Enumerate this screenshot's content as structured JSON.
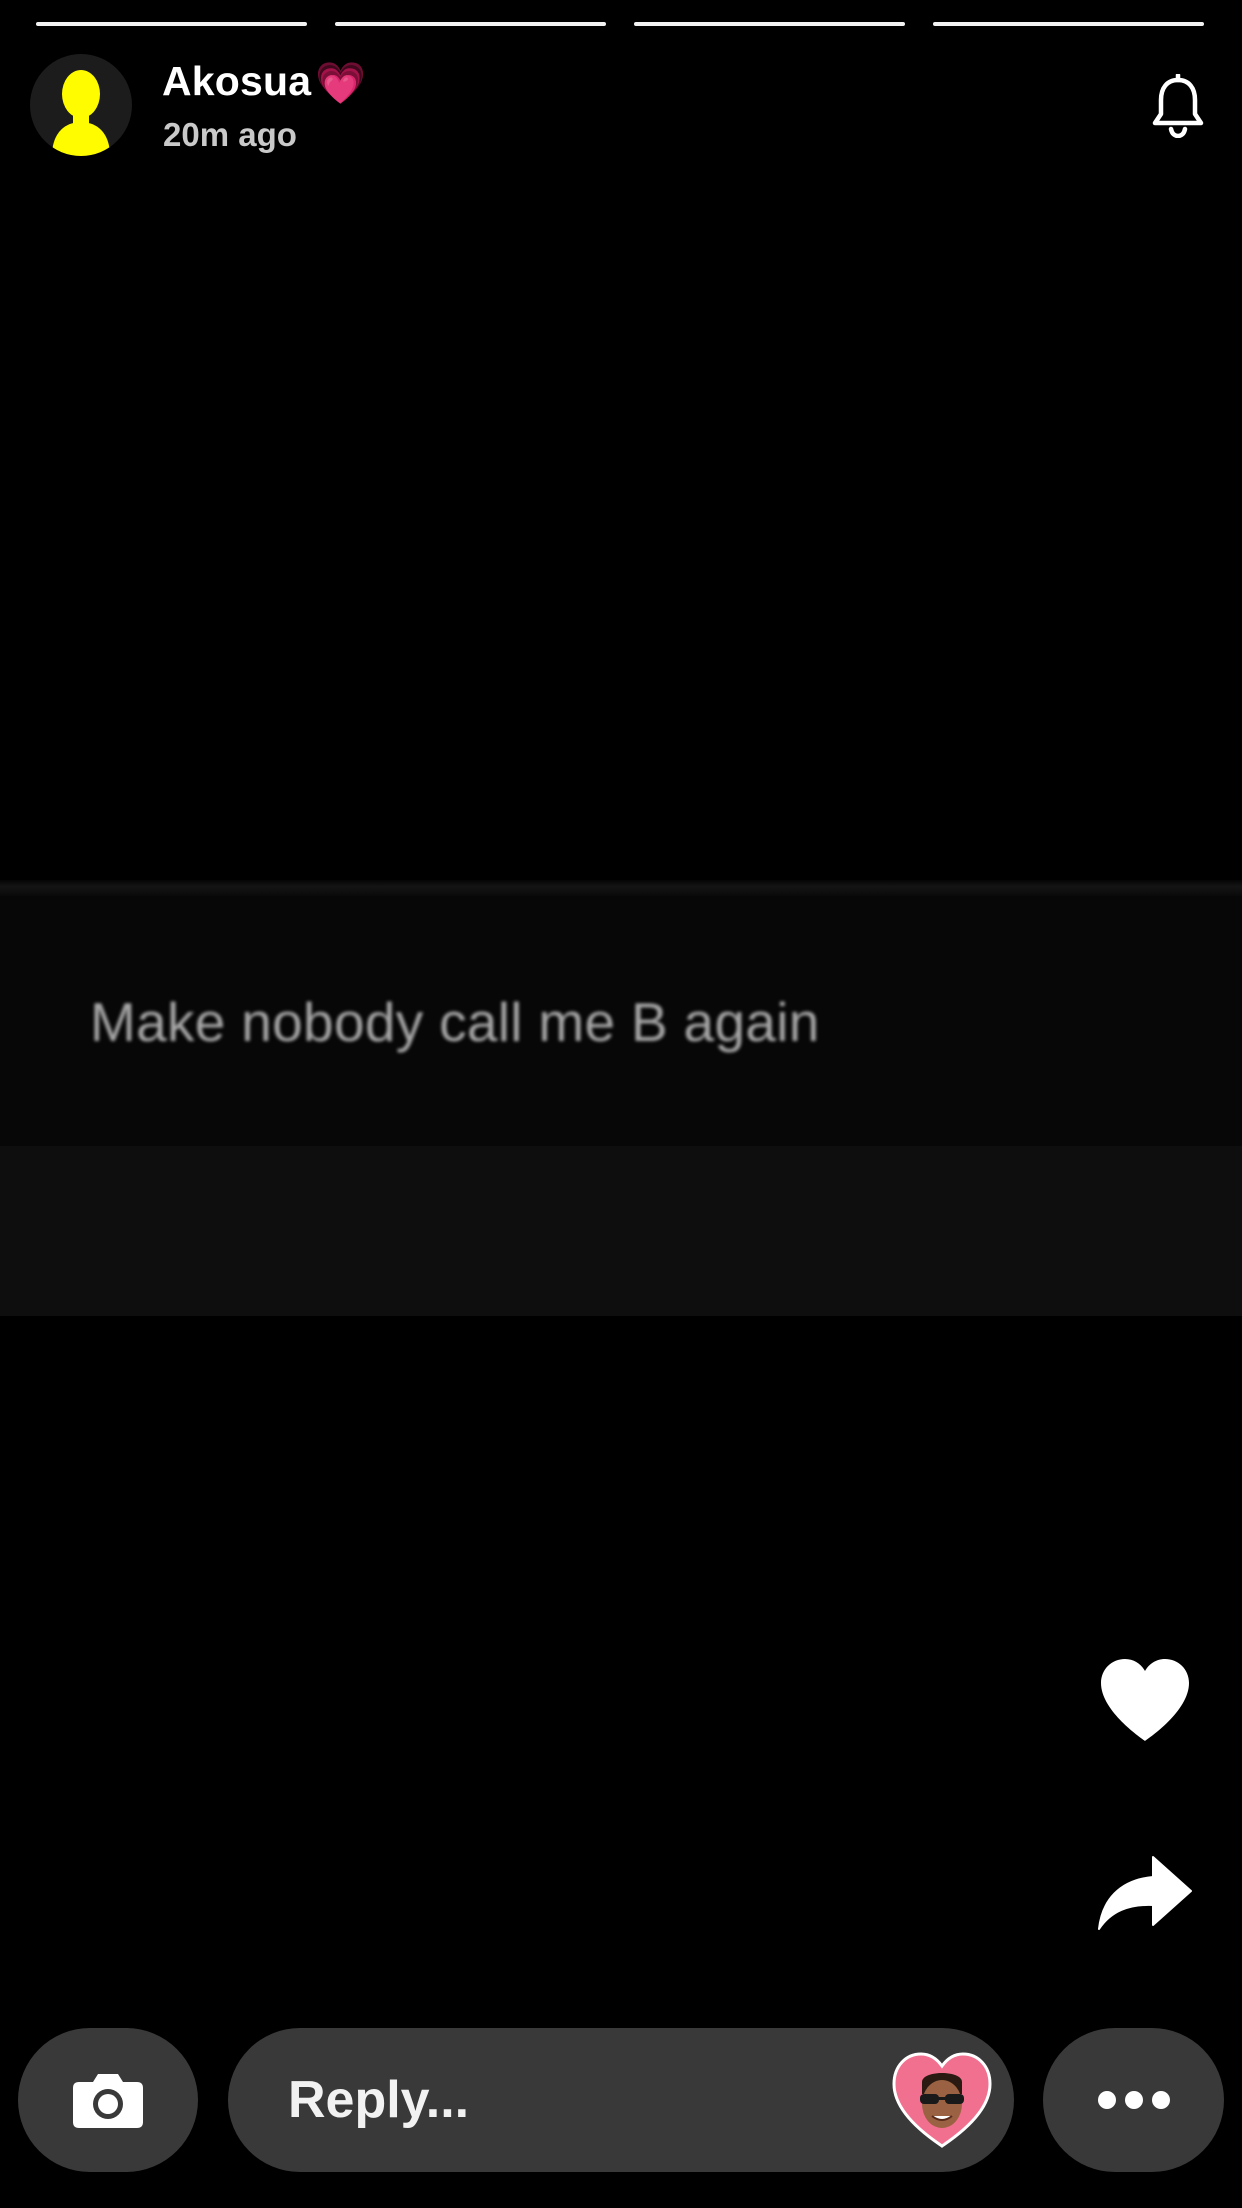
{
  "story": {
    "progress_segments": 4,
    "text": "Make nobody call me B again"
  },
  "header": {
    "username": "Akosua",
    "username_emoji": "💗",
    "timestamp": "20m ago",
    "avatar_icon": "ghost-avatar-icon",
    "bell_icon": "bell-icon"
  },
  "actions": {
    "like_icon": "heart-icon",
    "share_icon": "share-arrow-icon"
  },
  "bottom_bar": {
    "camera_icon": "camera-icon",
    "reply_placeholder": "Reply...",
    "bitmoji_icon": "bitmoji-heart-icon",
    "more_icon": "more-dots-icon"
  },
  "colors": {
    "background": "#000000",
    "pill": "#393939",
    "avatar_yellow": "#FFFC00",
    "heart_pink": "#F2708F"
  }
}
